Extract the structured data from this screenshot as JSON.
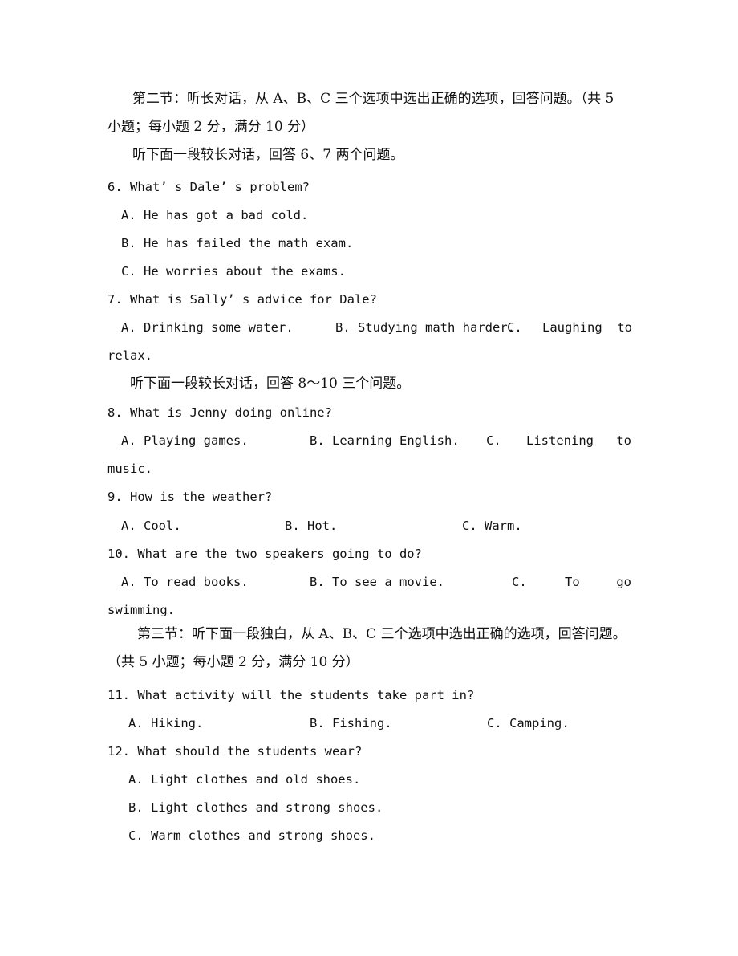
{
  "section2": {
    "heading_line1": "第二节：听长对话，从 A、B、C 三个选项中选出正确的选项，回答问题。（共 5",
    "heading_line2": "小题；每小题 2 分，满分 10 分）",
    "instruction_6_7": "听下面一段较长对话，回答 6、7 两个问题。",
    "instruction_8_10": "听下面一段较长对话，回答 8～10 三个问题。"
  },
  "section3": {
    "heading_line1": "第三节：听下面一段独白，从 A、B、C 三个选项中选出正确的选项，回答问题。",
    "heading_line2": "（共 5 小题；每小题 2 分，满分 10 分）"
  },
  "questions": [
    {
      "number": "6.",
      "text": "What’ s Dale’ s problem?",
      "options": [
        {
          "label": "A.",
          "text": "He has got a bad cold."
        },
        {
          "label": "B.",
          "text": "He has failed the math exam."
        },
        {
          "label": "C.",
          "text": "He worries about the exams."
        }
      ]
    },
    {
      "number": "7.",
      "text": "What is Sally’ s advice for Dale?",
      "options": [
        {
          "label": "A.",
          "text": "Drinking some water."
        },
        {
          "label": "B.",
          "text": "Studying math harder."
        },
        {
          "label": "C.",
          "text": "Laughing  to",
          "wrap": "relax."
        }
      ]
    },
    {
      "number": "8.",
      "text": "What is Jenny doing online?",
      "options": [
        {
          "label": "A.",
          "text": "Playing games."
        },
        {
          "label": "B.",
          "text": "Learning English."
        },
        {
          "label": "C.",
          "text": "Listening  to",
          "wrap": "music."
        }
      ]
    },
    {
      "number": "9.",
      "text": "How is the weather?",
      "options": [
        {
          "label": "A.",
          "text": "Cool."
        },
        {
          "label": "B.",
          "text": "Hot."
        },
        {
          "label": "C.",
          "text": "Warm."
        }
      ]
    },
    {
      "number": "10.",
      "text": "What are the two speakers going to do?",
      "options": [
        {
          "label": "A.",
          "text": "To read books."
        },
        {
          "label": "B.",
          "text": "To see a movie."
        },
        {
          "label": "C.",
          "text": "To  go",
          "wrap": "swimming."
        }
      ]
    },
    {
      "number": "11.",
      "text": "What activity will the students take part in?",
      "options": [
        {
          "label": "A.",
          "text": "Hiking."
        },
        {
          "label": "B.",
          "text": "Fishing."
        },
        {
          "label": "C.",
          "text": "Camping."
        }
      ]
    },
    {
      "number": "12.",
      "text": "What should the students wear?",
      "options": [
        {
          "label": "A.",
          "text": "Light clothes and old shoes."
        },
        {
          "label": "B.",
          "text": "Light clothes and strong shoes."
        },
        {
          "label": "C.",
          "text": "Warm clothes and strong shoes."
        }
      ]
    }
  ]
}
